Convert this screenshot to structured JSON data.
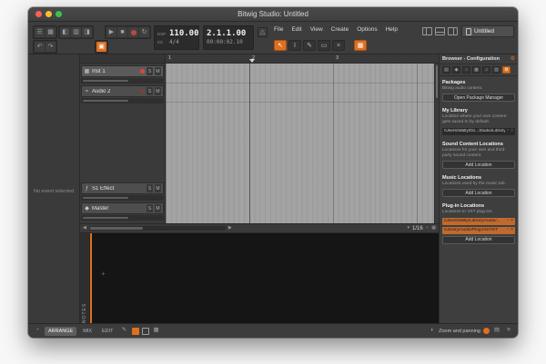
{
  "window": {
    "title": "Bitwig Studio: Untitled",
    "document_tab": "Untitled"
  },
  "menubar": {
    "items": [
      "File",
      "Edit",
      "View",
      "Create",
      "Options",
      "Help"
    ]
  },
  "transport": {
    "dsp_label": "DSP",
    "io_label": "I/O",
    "tempo": "110.00",
    "time_signature": "4/4",
    "position": "2.1.1.00",
    "time": "00:00:02.10"
  },
  "inspector": {
    "empty_text": "No event selected"
  },
  "arranger": {
    "ruler_marks": [
      "1",
      "2",
      "3"
    ],
    "tracks": [
      {
        "name": "Inst 1",
        "solo": "S",
        "mute": "M"
      },
      {
        "name": "Audio 2",
        "solo": "S",
        "mute": "M"
      },
      {
        "name": "S1 Effect",
        "solo": "S",
        "mute": "M"
      },
      {
        "name": "Master",
        "solo": "S",
        "mute": "M"
      }
    ],
    "snap_value": "1/16"
  },
  "editor": {
    "tab_label": "NOTES",
    "add_hint": "+"
  },
  "browser": {
    "title": "Browser - Configuration",
    "sections": [
      {
        "heading": "Packages",
        "description": "Bitwig audio content.",
        "button": "Open Package Manager"
      },
      {
        "heading": "My Library",
        "description": "Location where your own content gets saved to by default.",
        "paths": [
          "/Users/Wally/Do...Studio/Library"
        ]
      },
      {
        "heading": "Sound Content Locations",
        "description": "Locations for your own and third-party sound content.",
        "button": "Add Location"
      },
      {
        "heading": "Music Locations",
        "description": "Locations used by the music tab.",
        "button": "Add Location"
      },
      {
        "heading": "Plug-in Locations",
        "description": "Locations to VST plug-ins.",
        "paths": [
          "/Users/Wally/Library/Audio/...",
          "/Library/Audio/Plug-Ins/VST"
        ],
        "button": "Add Location"
      }
    ]
  },
  "statusbar": {
    "views": [
      "ARRANGE",
      "MIX",
      "EDIT"
    ],
    "zoom_label": "Zoom and panning"
  },
  "colors": {
    "accent": "#e0701f",
    "record": "#e04438"
  }
}
